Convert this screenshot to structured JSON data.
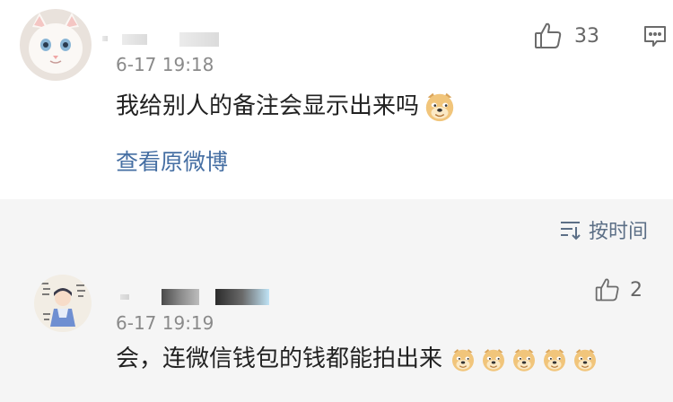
{
  "comment": {
    "timestamp": "6-17 19:18",
    "content": "我给别人的备注会显示出来吗",
    "link_label": "查看原微博",
    "like_count": "33",
    "like_icon": "thumbs-up-icon",
    "reply_icon": "comment-icon",
    "emoji": "doge-emoji"
  },
  "sort": {
    "label": "按时间",
    "icon": "sort-icon"
  },
  "reply": {
    "timestamp": "6-17 19:19",
    "content": "会，连微信钱包的钱都能拍出来",
    "like_count": "2",
    "emoji_count": 5
  },
  "colors": {
    "link": "#466fa3",
    "text": "#222222",
    "meta": "#8a8a8a",
    "background": "#f5f5f5"
  }
}
